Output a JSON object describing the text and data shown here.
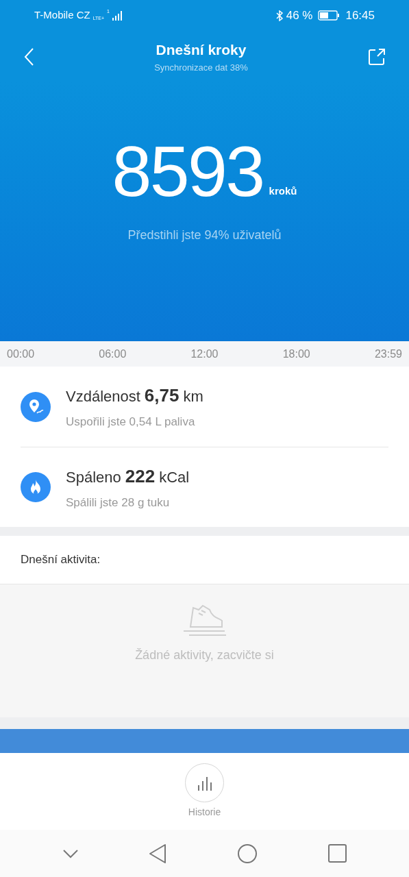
{
  "status_bar": {
    "carrier": "T-Mobile CZ",
    "network_type": "LTE+",
    "sim": "1",
    "battery_percent": "46 %",
    "time": "16:45"
  },
  "header": {
    "title": "Dnešní kroky",
    "subtitle": "Synchronizace dat 38%"
  },
  "hero": {
    "steps": "8593",
    "unit": "kroků",
    "comparison": "Předstihli jste 94% uživatelů"
  },
  "timeline": [
    "00:00",
    "06:00",
    "12:00",
    "18:00",
    "23:59"
  ],
  "stats": [
    {
      "kind": "distance",
      "label": "Vzdálenost",
      "value": "6,75",
      "unit": "km",
      "note": "Uspořili jste 0,54 L paliva"
    },
    {
      "kind": "calories",
      "label": "Spáleno",
      "value": "222",
      "unit": "kCal",
      "note": "Spálili jste 28 g tuku"
    }
  ],
  "activity": {
    "title": "Dnešní aktivita:",
    "empty_message": "Žádné aktivity, zacvičte si"
  },
  "bottom": {
    "history_label": "Historie"
  }
}
